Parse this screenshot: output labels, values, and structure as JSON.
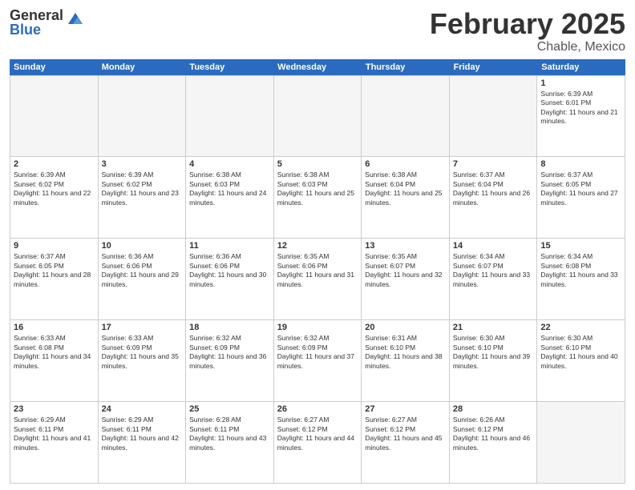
{
  "header": {
    "logo_general": "General",
    "logo_blue": "Blue",
    "title": "February 2025",
    "location": "Chable, Mexico"
  },
  "days_of_week": [
    "Sunday",
    "Monday",
    "Tuesday",
    "Wednesday",
    "Thursday",
    "Friday",
    "Saturday"
  ],
  "weeks": [
    [
      {
        "day": "",
        "empty": true
      },
      {
        "day": "",
        "empty": true
      },
      {
        "day": "",
        "empty": true
      },
      {
        "day": "",
        "empty": true
      },
      {
        "day": "",
        "empty": true
      },
      {
        "day": "",
        "empty": true
      },
      {
        "day": "1",
        "sunrise": "Sunrise: 6:39 AM",
        "sunset": "Sunset: 6:01 PM",
        "daylight": "Daylight: 11 hours and 21 minutes."
      }
    ],
    [
      {
        "day": "2",
        "sunrise": "Sunrise: 6:39 AM",
        "sunset": "Sunset: 6:02 PM",
        "daylight": "Daylight: 11 hours and 22 minutes."
      },
      {
        "day": "3",
        "sunrise": "Sunrise: 6:39 AM",
        "sunset": "Sunset: 6:02 PM",
        "daylight": "Daylight: 11 hours and 23 minutes."
      },
      {
        "day": "4",
        "sunrise": "Sunrise: 6:38 AM",
        "sunset": "Sunset: 6:03 PM",
        "daylight": "Daylight: 11 hours and 24 minutes."
      },
      {
        "day": "5",
        "sunrise": "Sunrise: 6:38 AM",
        "sunset": "Sunset: 6:03 PM",
        "daylight": "Daylight: 11 hours and 25 minutes."
      },
      {
        "day": "6",
        "sunrise": "Sunrise: 6:38 AM",
        "sunset": "Sunset: 6:04 PM",
        "daylight": "Daylight: 11 hours and 25 minutes."
      },
      {
        "day": "7",
        "sunrise": "Sunrise: 6:37 AM",
        "sunset": "Sunset: 6:04 PM",
        "daylight": "Daylight: 11 hours and 26 minutes."
      },
      {
        "day": "8",
        "sunrise": "Sunrise: 6:37 AM",
        "sunset": "Sunset: 6:05 PM",
        "daylight": "Daylight: 11 hours and 27 minutes."
      }
    ],
    [
      {
        "day": "9",
        "sunrise": "Sunrise: 6:37 AM",
        "sunset": "Sunset: 6:05 PM",
        "daylight": "Daylight: 11 hours and 28 minutes."
      },
      {
        "day": "10",
        "sunrise": "Sunrise: 6:36 AM",
        "sunset": "Sunset: 6:06 PM",
        "daylight": "Daylight: 11 hours and 29 minutes."
      },
      {
        "day": "11",
        "sunrise": "Sunrise: 6:36 AM",
        "sunset": "Sunset: 6:06 PM",
        "daylight": "Daylight: 11 hours and 30 minutes."
      },
      {
        "day": "12",
        "sunrise": "Sunrise: 6:35 AM",
        "sunset": "Sunset: 6:06 PM",
        "daylight": "Daylight: 11 hours and 31 minutes."
      },
      {
        "day": "13",
        "sunrise": "Sunrise: 6:35 AM",
        "sunset": "Sunset: 6:07 PM",
        "daylight": "Daylight: 11 hours and 32 minutes."
      },
      {
        "day": "14",
        "sunrise": "Sunrise: 6:34 AM",
        "sunset": "Sunset: 6:07 PM",
        "daylight": "Daylight: 11 hours and 33 minutes."
      },
      {
        "day": "15",
        "sunrise": "Sunrise: 6:34 AM",
        "sunset": "Sunset: 6:08 PM",
        "daylight": "Daylight: 11 hours and 33 minutes."
      }
    ],
    [
      {
        "day": "16",
        "sunrise": "Sunrise: 6:33 AM",
        "sunset": "Sunset: 6:08 PM",
        "daylight": "Daylight: 11 hours and 34 minutes."
      },
      {
        "day": "17",
        "sunrise": "Sunrise: 6:33 AM",
        "sunset": "Sunset: 6:09 PM",
        "daylight": "Daylight: 11 hours and 35 minutes."
      },
      {
        "day": "18",
        "sunrise": "Sunrise: 6:32 AM",
        "sunset": "Sunset: 6:09 PM",
        "daylight": "Daylight: 11 hours and 36 minutes."
      },
      {
        "day": "19",
        "sunrise": "Sunrise: 6:32 AM",
        "sunset": "Sunset: 6:09 PM",
        "daylight": "Daylight: 11 hours and 37 minutes."
      },
      {
        "day": "20",
        "sunrise": "Sunrise: 6:31 AM",
        "sunset": "Sunset: 6:10 PM",
        "daylight": "Daylight: 11 hours and 38 minutes."
      },
      {
        "day": "21",
        "sunrise": "Sunrise: 6:30 AM",
        "sunset": "Sunset: 6:10 PM",
        "daylight": "Daylight: 11 hours and 39 minutes."
      },
      {
        "day": "22",
        "sunrise": "Sunrise: 6:30 AM",
        "sunset": "Sunset: 6:10 PM",
        "daylight": "Daylight: 11 hours and 40 minutes."
      }
    ],
    [
      {
        "day": "23",
        "sunrise": "Sunrise: 6:29 AM",
        "sunset": "Sunset: 6:11 PM",
        "daylight": "Daylight: 11 hours and 41 minutes."
      },
      {
        "day": "24",
        "sunrise": "Sunrise: 6:29 AM",
        "sunset": "Sunset: 6:11 PM",
        "daylight": "Daylight: 11 hours and 42 minutes."
      },
      {
        "day": "25",
        "sunrise": "Sunrise: 6:28 AM",
        "sunset": "Sunset: 6:11 PM",
        "daylight": "Daylight: 11 hours and 43 minutes."
      },
      {
        "day": "26",
        "sunrise": "Sunrise: 6:27 AM",
        "sunset": "Sunset: 6:12 PM",
        "daylight": "Daylight: 11 hours and 44 minutes."
      },
      {
        "day": "27",
        "sunrise": "Sunrise: 6:27 AM",
        "sunset": "Sunset: 6:12 PM",
        "daylight": "Daylight: 11 hours and 45 minutes."
      },
      {
        "day": "28",
        "sunrise": "Sunrise: 6:26 AM",
        "sunset": "Sunset: 6:12 PM",
        "daylight": "Daylight: 11 hours and 46 minutes."
      },
      {
        "day": "",
        "empty": true
      }
    ]
  ]
}
